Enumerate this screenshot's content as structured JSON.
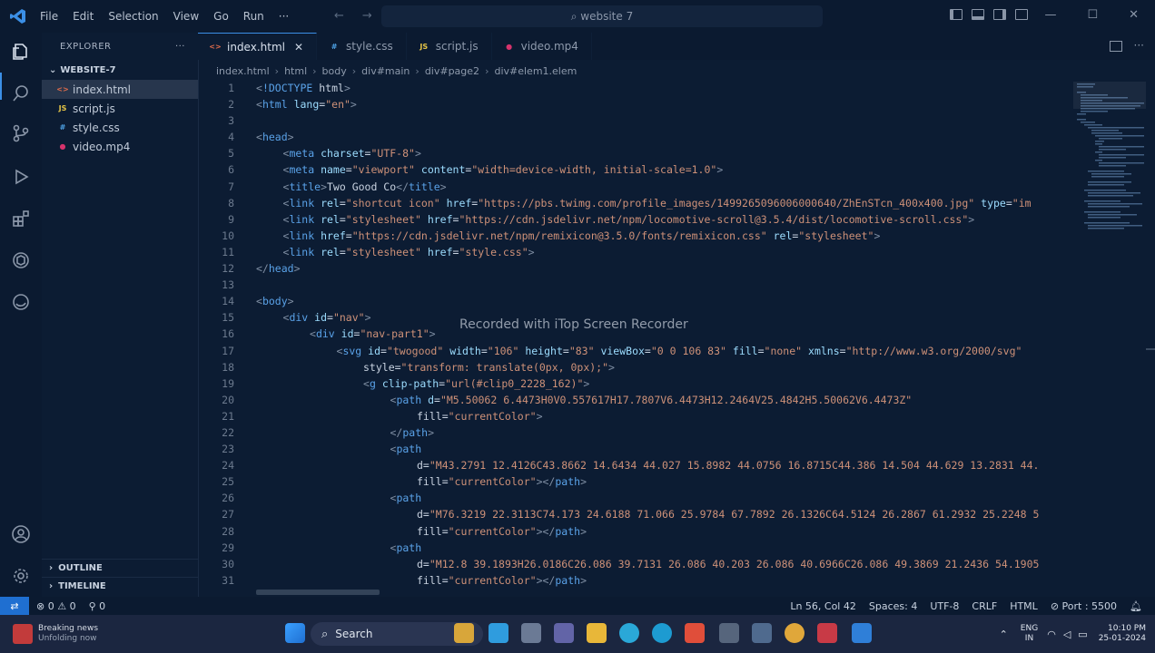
{
  "titlebar": {
    "menu": [
      "File",
      "Edit",
      "Selection",
      "View",
      "Go",
      "Run",
      "···"
    ],
    "search_text": "⌕ website 7"
  },
  "explorer": {
    "title": "EXPLORER",
    "more": "···",
    "folder": "WEBSITE-7",
    "files": [
      {
        "icon": "<>",
        "name": "index.html",
        "color": "#e06c4b",
        "selected": true
      },
      {
        "icon": "JS",
        "name": "script.js",
        "color": "#e5c547"
      },
      {
        "icon": "#",
        "name": "style.css",
        "color": "#4fa3e6"
      },
      {
        "icon": "●",
        "name": "video.mp4",
        "color": "#d6336c"
      }
    ],
    "outline": "OUTLINE",
    "timeline": "TIMELINE"
  },
  "tabs": [
    {
      "icon": "<>",
      "label": "index.html",
      "color": "#e06c4b",
      "active": true
    },
    {
      "icon": "#",
      "label": "style.css",
      "color": "#4fa3e6"
    },
    {
      "icon": "JS",
      "label": "script.js",
      "color": "#e5c547"
    },
    {
      "icon": "●",
      "label": "video.mp4",
      "color": "#d6336c"
    }
  ],
  "breadcrumb": [
    "index.html",
    "html",
    "body",
    "div#main",
    "div#page2",
    "div#elem1.elem"
  ],
  "code_lines": [
    {
      "n": "1",
      "indent": 0,
      "text": "<!DOCTYPE html>"
    },
    {
      "n": "2",
      "indent": 0,
      "text": "<html lang=\"en\">"
    },
    {
      "n": "3",
      "indent": 0,
      "text": ""
    },
    {
      "n": "4",
      "indent": 0,
      "text": "<head>"
    },
    {
      "n": "5",
      "indent": 1,
      "text": "<meta charset=\"UTF-8\">"
    },
    {
      "n": "6",
      "indent": 1,
      "text": "<meta name=\"viewport\" content=\"width=device-width, initial-scale=1.0\">"
    },
    {
      "n": "7",
      "indent": 1,
      "text": "<title>Two Good Co</title>"
    },
    {
      "n": "8",
      "indent": 1,
      "text": "<link rel=\"shortcut icon\" href=\"https://pbs.twimg.com/profile_images/1499265096006000640/ZhEnSTcn_400x400.jpg\" type=\"im"
    },
    {
      "n": "9",
      "indent": 1,
      "text": "<link rel=\"stylesheet\" href=\"https://cdn.jsdelivr.net/npm/locomotive-scroll@3.5.4/dist/locomotive-scroll.css\">"
    },
    {
      "n": "10",
      "indent": 1,
      "text": "<link href=\"https://cdn.jsdelivr.net/npm/remixicon@3.5.0/fonts/remixicon.css\" rel=\"stylesheet\">"
    },
    {
      "n": "11",
      "indent": 1,
      "text": "<link rel=\"stylesheet\" href=\"style.css\">"
    },
    {
      "n": "12",
      "indent": 0,
      "text": "</head>"
    },
    {
      "n": "13",
      "indent": 0,
      "text": ""
    },
    {
      "n": "14",
      "indent": 0,
      "text": "<body>"
    },
    {
      "n": "15",
      "indent": 1,
      "text": "<div id=\"nav\">"
    },
    {
      "n": "16",
      "indent": 2,
      "text": "<div id=\"nav-part1\">"
    },
    {
      "n": "17",
      "indent": 3,
      "text": "<svg id=\"twogood\" width=\"106\" height=\"83\" viewBox=\"0 0 106 83\" fill=\"none\" xmlns=\"http://www.w3.org/2000/svg\""
    },
    {
      "n": "18",
      "indent": 4,
      "text": "style=\"transform: translate(0px, 0px);\">"
    },
    {
      "n": "19",
      "indent": 4,
      "text": "<g clip-path=\"url(#clip0_2228_162)\">"
    },
    {
      "n": "20",
      "indent": 5,
      "text": "<path d=\"M5.50062 6.4473H0V0.557617H17.7807V6.4473H12.2464V25.4842H5.50062V6.4473Z\""
    },
    {
      "n": "21",
      "indent": 6,
      "text": "fill=\"currentColor\">"
    },
    {
      "n": "22",
      "indent": 5,
      "text": "</path>"
    },
    {
      "n": "23",
      "indent": 5,
      "text": "<path"
    },
    {
      "n": "24",
      "indent": 6,
      "text": "d=\"M43.2791 12.4126C43.8662 14.6434 44.027 15.8982 44.0756 16.8715C44.386 14.504 44.629 13.2831 44."
    },
    {
      "n": "25",
      "indent": 6,
      "text": "fill=\"currentColor\"></path>"
    },
    {
      "n": "26",
      "indent": 5,
      "text": "<path"
    },
    {
      "n": "27",
      "indent": 6,
      "text": "d=\"M76.3219 22.3113C74.173 24.6188 71.066 25.9784 67.7892 26.1326C64.5124 26.2867 61.2932 25.2248 5"
    },
    {
      "n": "28",
      "indent": 6,
      "text": "fill=\"currentColor\"></path>"
    },
    {
      "n": "29",
      "indent": 5,
      "text": "<path"
    },
    {
      "n": "30",
      "indent": 6,
      "text": "d=\"M12.8 39.1893H26.0186C26.086 39.7131 26.086 40.203 26.086 40.6966C26.086 49.3869 21.2436 54.1905"
    },
    {
      "n": "31",
      "indent": 6,
      "text": "fill=\"currentColor\"></path>"
    }
  ],
  "watermark": "Recorded with iTop Screen Recorder",
  "status": {
    "remote": "⇄",
    "problems": "⊗ 0 ⚠ 0",
    "ports": "⚲ 0",
    "position": "Ln 56, Col 42",
    "spaces": "Spaces: 4",
    "encoding": "UTF-8",
    "eol": "CRLF",
    "language": "HTML",
    "port": "⊘ Port : 5500"
  },
  "taskbar": {
    "news_line1": "Breaking news",
    "news_line2": "Unfolding now",
    "search": "Search",
    "lang1": "ENG",
    "lang2": "IN",
    "time": "10:10 PM",
    "date": "25-01-2024"
  }
}
